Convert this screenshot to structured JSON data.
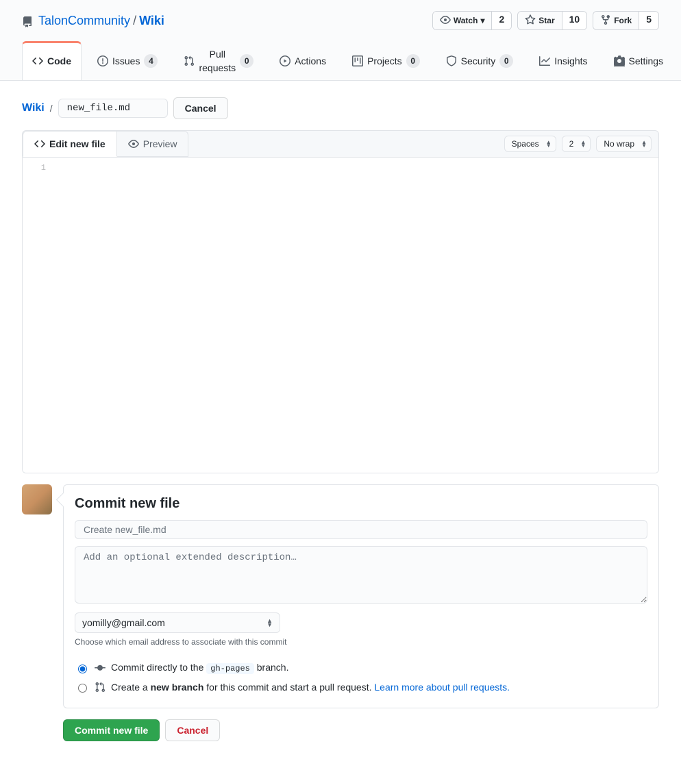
{
  "breadcrumb": {
    "owner": "TalonCommunity",
    "repo": "Wiki"
  },
  "actions": {
    "watch_label": "Watch",
    "watch_count": "2",
    "star_label": "Star",
    "star_count": "10",
    "fork_label": "Fork",
    "fork_count": "5"
  },
  "nav": {
    "code": "Code",
    "issues": "Issues",
    "issues_count": "4",
    "pulls": "Pull requests",
    "pulls_count": "0",
    "actions": "Actions",
    "projects": "Projects",
    "projects_count": "0",
    "security": "Security",
    "security_count": "0",
    "insights": "Insights",
    "settings": "Settings"
  },
  "path": {
    "root": "Wiki",
    "filename": "new_file.md",
    "cancel": "Cancel"
  },
  "editor": {
    "tab_edit": "Edit new file",
    "tab_preview": "Preview",
    "indent_mode": "Spaces",
    "indent_size": "2",
    "wrap_mode": "No wrap",
    "line1": "1"
  },
  "commit": {
    "heading": "Commit new file",
    "summary_placeholder": "Create new_file.md",
    "description_placeholder": "Add an optional extended description…",
    "email": "yomilly@gmail.com",
    "email_help": "Choose which email address to associate with this commit",
    "opt1_pre": "Commit directly to the ",
    "opt1_branch": "gh-pages",
    "opt1_post": " branch.",
    "opt2_pre": "Create a ",
    "opt2_bold": "new branch",
    "opt2_post": " for this commit and start a pull request. ",
    "opt2_link": "Learn more about pull requests.",
    "submit": "Commit new file",
    "cancel": "Cancel"
  }
}
